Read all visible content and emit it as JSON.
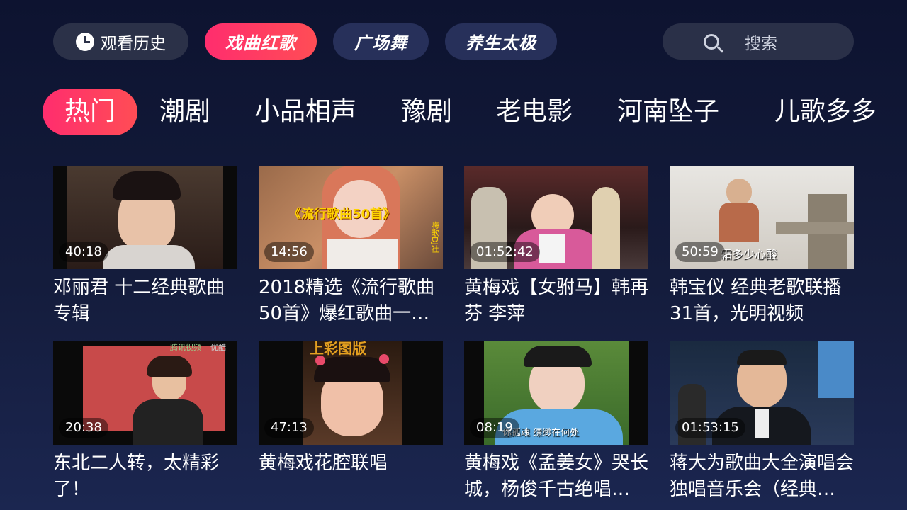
{
  "topbar": {
    "history_label": "观看历史",
    "categories": [
      "戏曲红歌",
      "广场舞",
      "养生太极"
    ],
    "search_label": "搜索"
  },
  "tabs": [
    "热门",
    "潮剧",
    "小品相声",
    "豫剧",
    "老电影",
    "河南坠子",
    "儿歌多多"
  ],
  "videos": [
    {
      "title": "邓丽君 十二经典歌曲专辑",
      "duration": "40:18"
    },
    {
      "title": "2018精选《流行歌曲50首》爆红歌曲一…",
      "duration": "14:56"
    },
    {
      "title": "黄梅戏【女驸马】韩再芬 李萍",
      "duration": "01:52:42"
    },
    {
      "title": "韩宝仪 经典老歌联播31首，光明视频",
      "duration": "50:59"
    },
    {
      "title": "东北二人转，太精彩了！",
      "duration": "20:38"
    },
    {
      "title": "黄梅戏花腔联唱",
      "duration": "47:13"
    },
    {
      "title": "黄梅戏《孟姜女》哭长城，杨俊千古绝唱…",
      "duration": "08:19"
    },
    {
      "title": "蒋大为歌曲大全演唱会独唱音乐会（经典…",
      "duration": "01:53:15"
    }
  ],
  "thumb_texts": {
    "v2_banner": "《流行歌曲50首》",
    "v3_corner": "嗨歌DJ社",
    "v4_caption": "霜多少心酸",
    "v5_logo": "腾讯视频",
    "v5_sublogo": "优酷",
    "v6_caption": "上彩图版",
    "v7_caption": "你孤魂 缥缈在何处"
  }
}
